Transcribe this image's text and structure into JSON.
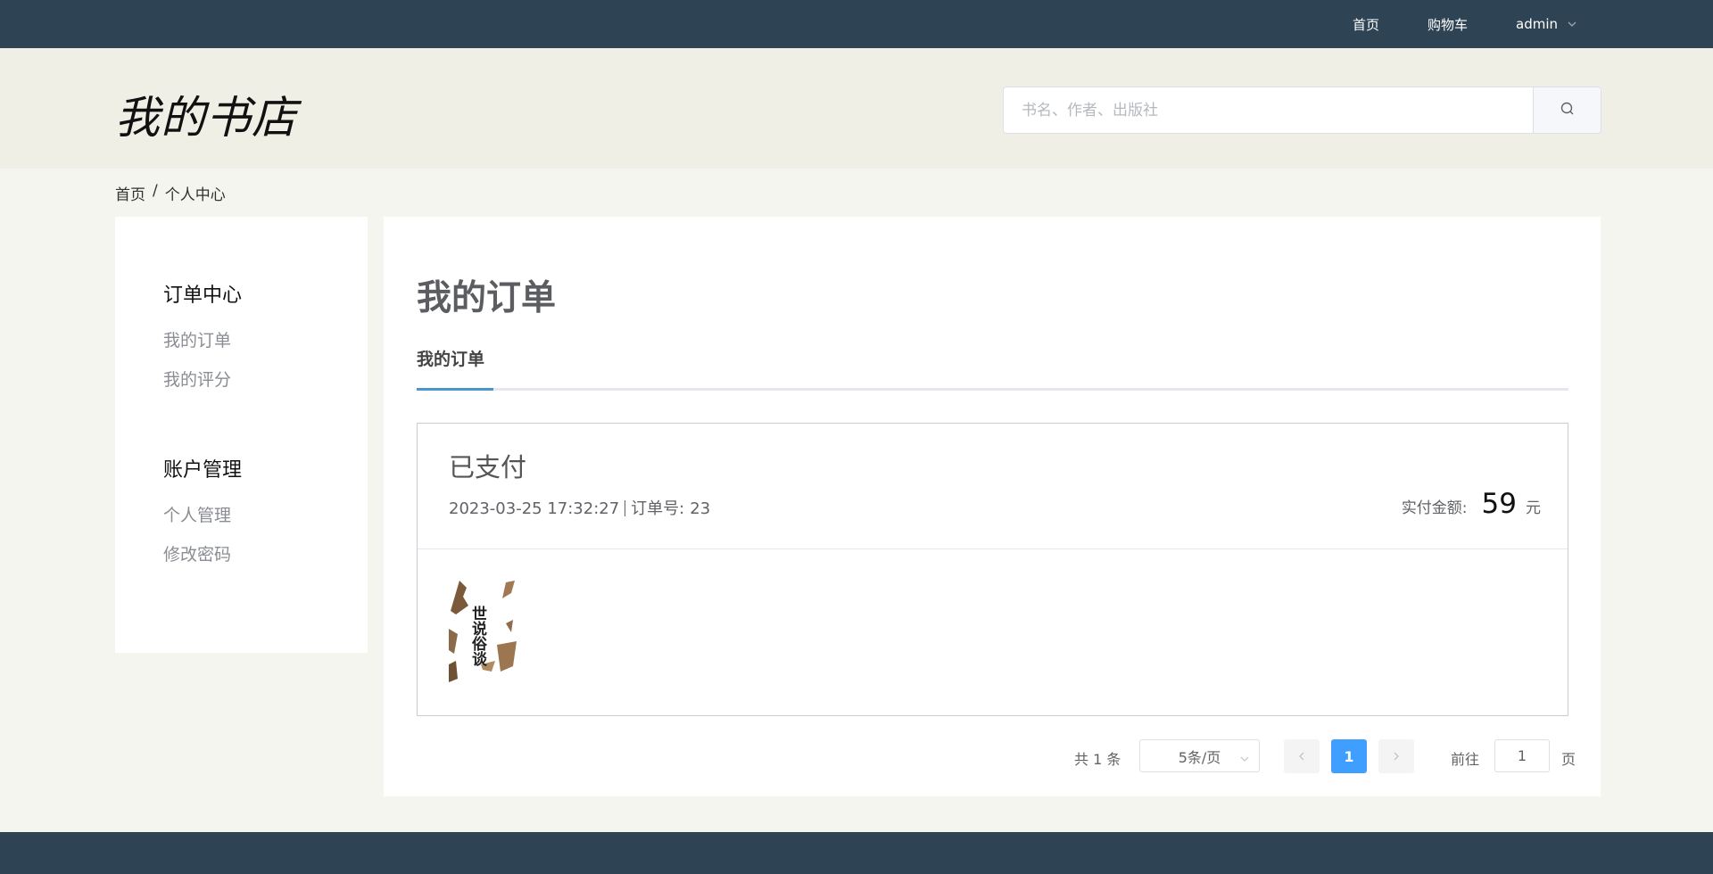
{
  "topnav": {
    "home": "首页",
    "cart": "购物车",
    "user": "admin"
  },
  "header": {
    "logo": "我的书店",
    "search_placeholder": "书名、作者、出版社",
    "search_value": ""
  },
  "breadcrumb": [
    "首页",
    "个人中心"
  ],
  "sidebar": {
    "groups": [
      {
        "title": "订单中心",
        "items": [
          "我的订单",
          "我的评分"
        ]
      },
      {
        "title": "账户管理",
        "items": [
          "个人管理",
          "修改密码"
        ]
      }
    ]
  },
  "main": {
    "title": "我的订单",
    "tab": "我的订单",
    "order": {
      "status": "已支付",
      "datetime": "2023-03-25 17:32:27",
      "order_no_label": "订单号:",
      "order_no": "23",
      "amount_label": "实付金额:",
      "amount": "59",
      "currency": "元",
      "book_cover_text": "世说俗谈"
    }
  },
  "pagination": {
    "total_text": "共 1 条",
    "page_size": "5条/页",
    "current_page": "1",
    "goto_label": "前往",
    "goto_value": "1",
    "page_unit": "页"
  },
  "colors": {
    "nav_bg": "#2e4354",
    "accent": "#409eff",
    "tab_underline": "#4a96cf"
  }
}
